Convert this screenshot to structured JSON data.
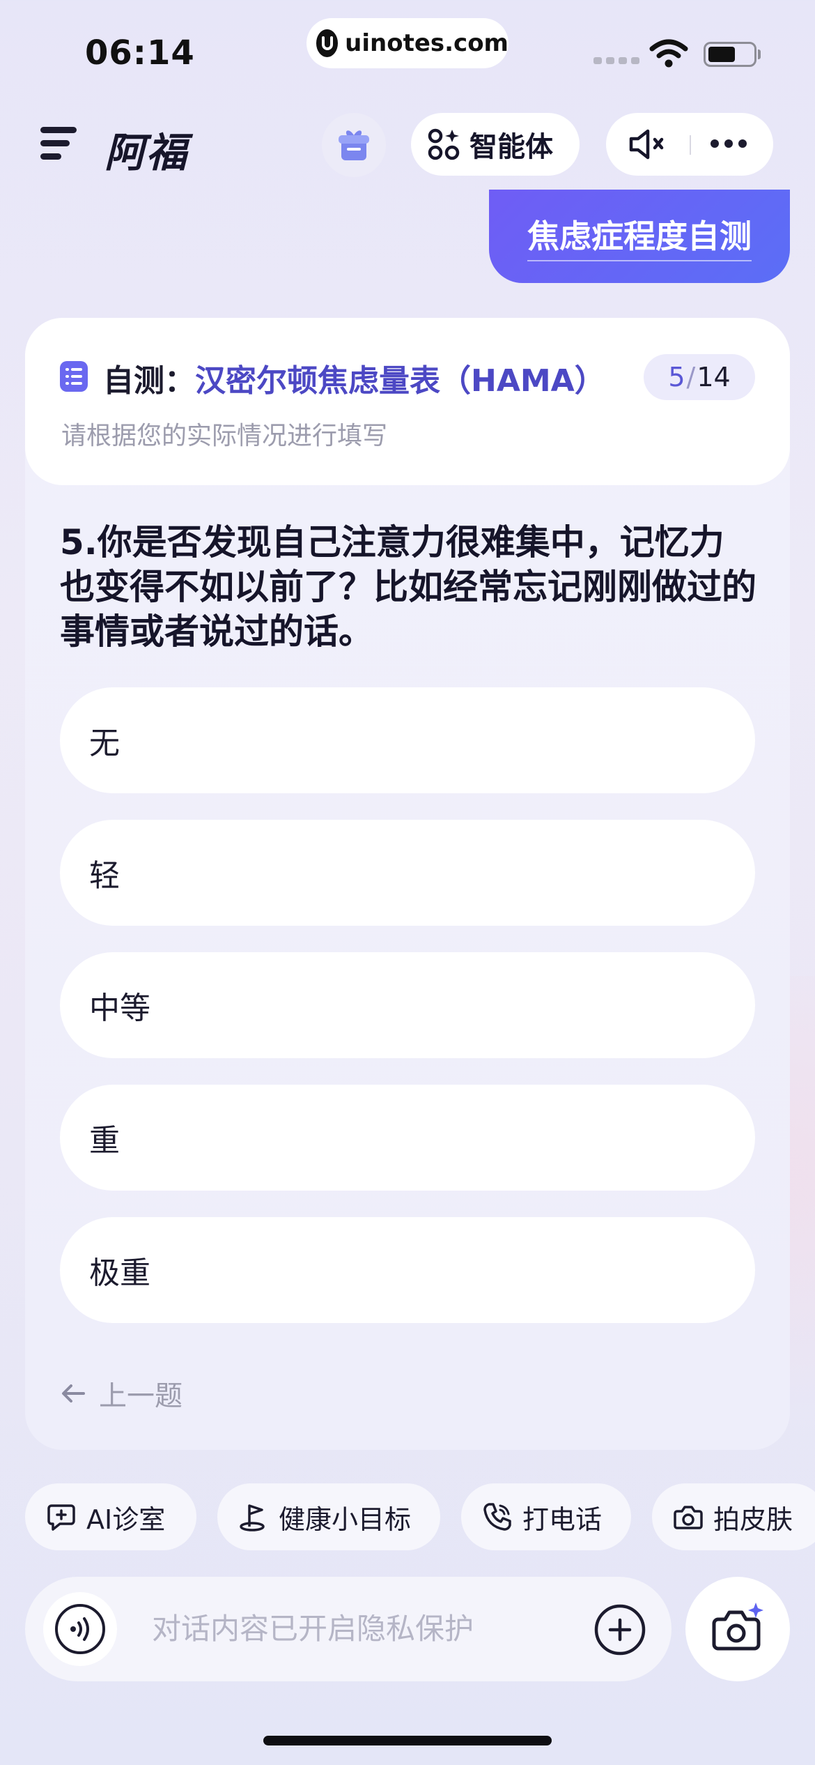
{
  "status_bar": {
    "time": "06:14",
    "url": "uinotes.com"
  },
  "header": {
    "title": "阿福",
    "agent_label": "智能体",
    "icons": [
      "menu-icon",
      "gift-icon",
      "agent-grid-icon",
      "speaker-mute-icon",
      "more-icon"
    ]
  },
  "chat": {
    "user_message": "焦虑症程度自测"
  },
  "survey": {
    "title_prefix": "自测：",
    "title_name": "汉密尔顿焦虑量表（HAMA）",
    "progress_current": "5",
    "progress_sep": "/",
    "progress_total": "14",
    "subtitle": "请根据您的实际情况进行填写",
    "question": "5.你是否发现自己注意力很难集中，记忆力也变得不如以前了？比如经常忘记刚刚做过的事情或者说过的话。",
    "options": [
      "无",
      "轻",
      "中等",
      "重",
      "极重"
    ],
    "prev_label": "上一题"
  },
  "quick_actions": [
    {
      "label": "AI诊室",
      "icon": "chat-plus-icon"
    },
    {
      "label": "健康小目标",
      "icon": "goal-icon"
    },
    {
      "label": "打电话",
      "icon": "phone-icon"
    },
    {
      "label": "拍皮肤",
      "icon": "camera-icon"
    }
  ],
  "input": {
    "placeholder": "对话内容已开启隐私保护"
  },
  "colors": {
    "accent": "#5b59d8",
    "bubble_start": "#6f5df5",
    "bubble_end": "#5b6ef6"
  }
}
